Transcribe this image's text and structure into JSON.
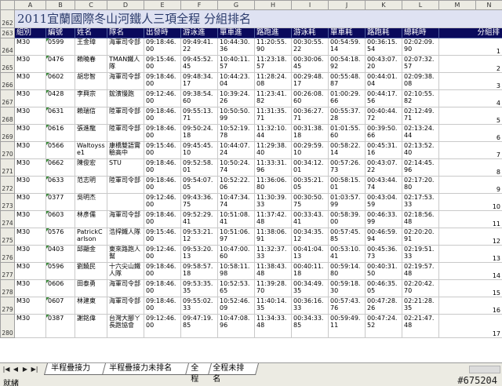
{
  "title": "2011宜蘭國際冬山河鐵人三項全程  分組排名",
  "columns": [
    "A",
    "B",
    "C",
    "D",
    "E",
    "F",
    "G",
    "H",
    "I",
    "J",
    "K",
    "L",
    "M",
    "N"
  ],
  "headers": [
    "組別",
    "編號",
    "姓名",
    "隊名",
    "出發時",
    "游泳進",
    "單車進",
    "路跑進",
    "游泳耗",
    "單車耗",
    "路跑耗",
    "總耗時",
    "分組排"
  ],
  "title_row_num": "262",
  "header_row_num": "263",
  "rows": [
    {
      "n": "264",
      "c": [
        "M30",
        "0599",
        "王金璋",
        "海軍司令部",
        "09:18:46.00",
        "09:49:41.22",
        "10:44:30.36",
        "11:20:55.90",
        "00:30:55.22",
        "00:54:59.14",
        "00:36:15.54",
        "02:02:09.90",
        "1"
      ]
    },
    {
      "n": "265",
      "c": [
        "M30",
        "0476",
        "賴曉春",
        "TMAN鐵人隊",
        "09:15:46.00",
        "09:45:52.45",
        "10:40:11.57",
        "11:23:18.57",
        "00:30:06.45",
        "00:54:18.92",
        "00:43:07.20",
        "02:07:32.57",
        "2"
      ]
    },
    {
      "n": "266",
      "c": [
        "M30",
        "0602",
        "胡忠智",
        "海軍司令部",
        "09:18:46.00",
        "09:48:34.17",
        "10:44:23.04",
        "11:28:24.08",
        "00:29:48.17",
        "00:55:48.87",
        "00:44:01.04",
        "02:09:38.08",
        "3"
      ]
    },
    {
      "n": "267",
      "c": [
        "M30",
        "0428",
        "李興宗",
        "鋐濱慢跑",
        "09:12:46.00",
        "09:38:54.60",
        "10:39:24.26",
        "11:23:41.82",
        "00:26:08.60",
        "01:00:29.66",
        "00:44:17.56",
        "02:10:55.82",
        "4"
      ]
    },
    {
      "n": "268",
      "c": [
        "M30",
        "0631",
        "賴瑞信",
        "陸軍司令部",
        "09:18:46.00",
        "09:55:13.71",
        "10:50:50.99",
        "11:31:35.71",
        "00:36:27.71",
        "00:55:37.28",
        "00:40:44.72",
        "02:12:49.71",
        "5"
      ]
    },
    {
      "n": "269",
      "c": [
        "M30",
        "0616",
        "張進龍",
        "陸軍司令部",
        "09:18:46.00",
        "09:50:24.18",
        "10:52:19.78",
        "11:32:10.44",
        "00:31:38.18",
        "01:01:55.60",
        "00:39:50.66",
        "02:13:24.44",
        "6"
      ]
    },
    {
      "n": "270",
      "c": [
        "M30",
        "0566",
        "Waltoysse1",
        "康橋雙語實驗高中",
        "09:15:46.00",
        "09:45:45.10",
        "10:44:07.24",
        "11:29:38.40",
        "00:29:59.10",
        "00:58:22.14",
        "00:45:31.16",
        "02:13:52.40",
        "7"
      ]
    },
    {
      "n": "271",
      "c": [
        "M30",
        "0662",
        "陳俊宏",
        "STU",
        "09:18:46.00",
        "09:52:58.01",
        "10:50:24.74",
        "11:33:31.96",
        "00:34:12.01",
        "00:57:26.73",
        "00:43:07.22",
        "02:14:45.96",
        "8"
      ]
    },
    {
      "n": "272",
      "c": [
        "M30",
        "0633",
        "范志明",
        "陸軍司令部",
        "09:18:46.00",
        "09:54:07.05",
        "10:52:22.06",
        "11:36:06.80",
        "00:35:21.05",
        "00:58:15.01",
        "00:43:44.74",
        "02:17:20.80",
        "9"
      ]
    },
    {
      "n": "273",
      "c": [
        "M30",
        "0377",
        "吳明杰",
        "",
        "09:12:46.00",
        "09:43:36.75",
        "10:47:34.74",
        "11:30:39.33",
        "00:30:50.75",
        "01:03:57.99",
        "00:43:04.59",
        "02:17:53.33",
        "10"
      ]
    },
    {
      "n": "274",
      "c": [
        "M30",
        "0603",
        "林彥儒",
        "海軍司令部",
        "09:18:46.00",
        "09:52:29.41",
        "10:51:08.41",
        "11:37:42.48",
        "00:33:43.41",
        "00:58:39.00",
        "00:46:33.99",
        "02:18:56.48",
        "11"
      ]
    },
    {
      "n": "275",
      "c": [
        "M30",
        "0576",
        "PatrickCarlson",
        "浩捍鐵人隊",
        "09:15:46.00",
        "09:53:21.12",
        "10:51:06.97",
        "11:38:06.91",
        "00:34:35.12",
        "00:57:45.85",
        "00:46:59.94",
        "02:20:20.91",
        "12"
      ]
    },
    {
      "n": "276",
      "c": [
        "M30",
        "0403",
        "邱顯金",
        "東來路跑人幫",
        "09:12:46.00",
        "09:53:20.13",
        "10:47:00.60",
        "11:32:37.33",
        "00:41:04.13",
        "00:53:10.41",
        "00:45:36.73",
        "02:19:51.33",
        "13"
      ]
    },
    {
      "n": "277",
      "c": [
        "M30",
        "0596",
        "劉饒民",
        "十六尖山鐵人隊",
        "09:18:46.00",
        "09:58:57.18",
        "10:58:11.98",
        "11:38:43.48",
        "00:40:11.18",
        "00:59:14.80",
        "00:40:31.50",
        "02:19:57.48",
        "14"
      ]
    },
    {
      "n": "278",
      "c": [
        "M30",
        "0606",
        "田泰勇",
        "海軍司令部",
        "09:18:46.00",
        "09:53:35.35",
        "10:52:53.65",
        "11:39:28.70",
        "00:34:49.35",
        "00:59:18.30",
        "00:46:35.05",
        "02:20:42.70",
        "15"
      ]
    },
    {
      "n": "279",
      "c": [
        "M30",
        "0607",
        "林建東",
        "海軍司令部",
        "09:18:46.00",
        "09:55:02.33",
        "10:52:46.09",
        "11:40:14.35",
        "00:36:16.33",
        "00:57:43.76",
        "00:47:28.26",
        "02:21:28.35",
        "16"
      ]
    },
    {
      "n": "280",
      "c": [
        "M30",
        "0387",
        "謝銘偉",
        "台灣大腳ㄚ長跑協會",
        "09:12:46.00",
        "09:47:19.85",
        "10:47:08.96",
        "11:34:33.48",
        "00:34:33.85",
        "00:59:49.11",
        "00:47:24.52",
        "02:21:47.48",
        "17"
      ]
    }
  ],
  "tabs": [
    "半程疊接力",
    "半程疊接力未排名",
    "全程",
    "全程未排名"
  ],
  "active_tab": "全程",
  "status": "就緒",
  "watermark": "#675204"
}
